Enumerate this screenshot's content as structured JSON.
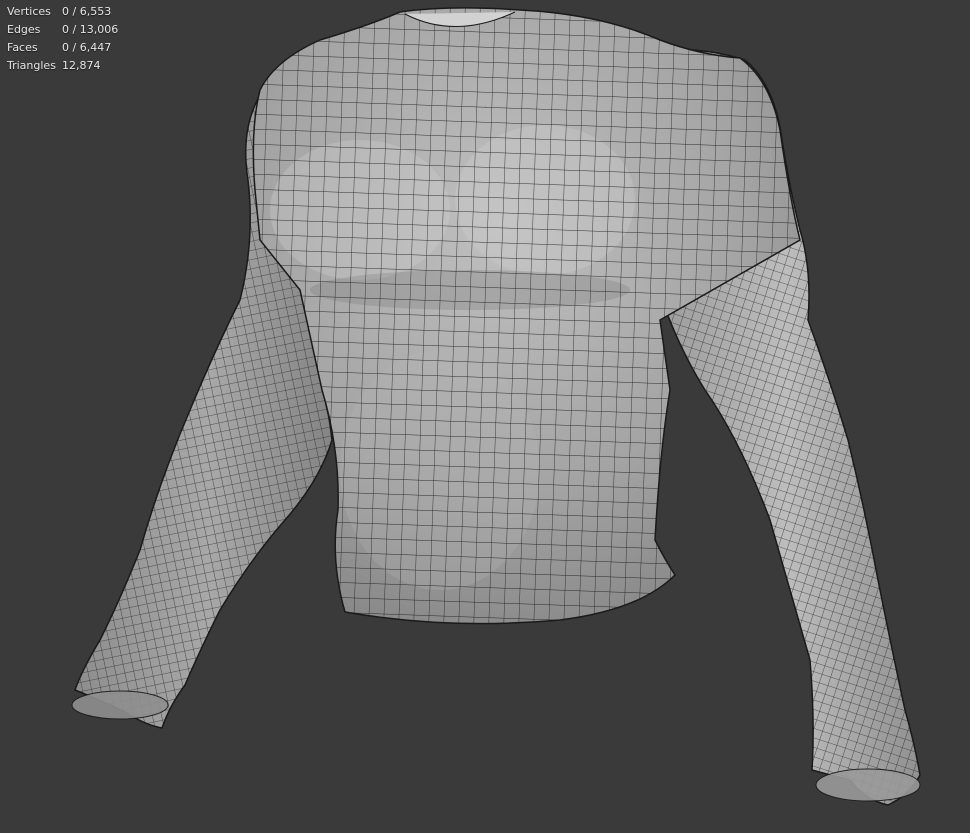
{
  "overlay": {
    "stats": [
      {
        "label": "Vertices",
        "value": "0 / 6,553"
      },
      {
        "label": "Edges",
        "value": "0 / 13,006"
      },
      {
        "label": "Faces",
        "value": "0 / 6,447"
      },
      {
        "label": "Triangles",
        "value": "12,874"
      }
    ]
  },
  "colors": {
    "viewport_background": "#3a3a3a",
    "mesh_surface": "#9c9c9c",
    "mesh_highlight": "#c4c4c4",
    "wireframe": "#1e1e1e",
    "overlay_text": "#e6e6e6"
  }
}
